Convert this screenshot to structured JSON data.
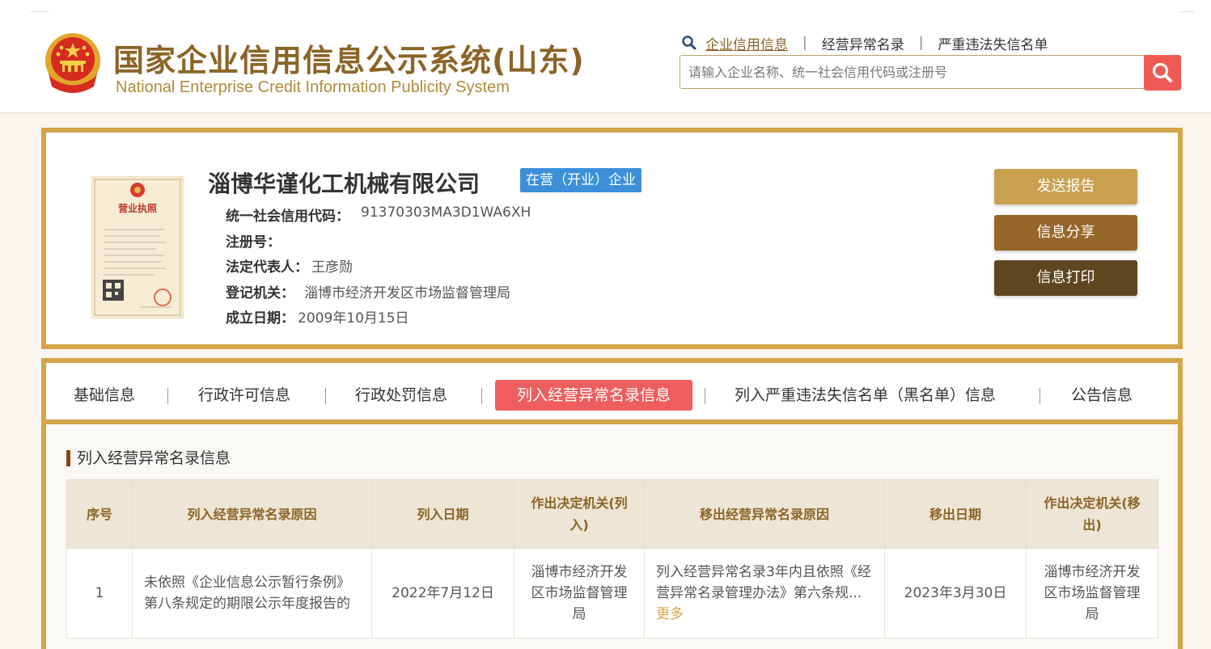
{
  "header": {
    "title": "国家企业信用信息公示系统(山东)",
    "subtitle": "National Enterprise Credit Information Publicity System",
    "nav": {
      "credit_info": "企业信用信息",
      "abnormal_list": "经营异常名录",
      "serious_violation": "严重违法失信名单"
    },
    "search": {
      "placeholder": "请输入企业名称、统一社会信用代码或注册号"
    }
  },
  "company": {
    "name": "淄博华谨化工机械有限公司",
    "status": "在营（开业）企业",
    "credit_code_label": "统一社会信用代码：",
    "credit_code": "91370303MA3D1WA6XH",
    "reg_no_label": "注册号：",
    "reg_no": "",
    "legal_rep_label": "法定代表人：",
    "legal_rep": "王彦勋",
    "authority_label": "登记机关：",
    "authority": "淄博市经济开发区市场监督管理局",
    "founded_label": "成立日期：",
    "founded": "2009年10月15日",
    "license_image": {
      "title": "营业执照"
    }
  },
  "actions": {
    "send_report": "发送报告",
    "share": "信息分享",
    "print": "信息打印"
  },
  "tabs": [
    {
      "label": "基础信息"
    },
    {
      "label": "行政许可信息"
    },
    {
      "label": "行政处罚信息"
    },
    {
      "label": "列入经营异常名录信息"
    },
    {
      "label": "列入严重违法失信名单（黑名单）信息"
    },
    {
      "label": "公告信息"
    }
  ],
  "section": {
    "title": "列入经营异常名录信息",
    "columns": [
      "序号",
      "列入经营异常名录原因",
      "列入日期",
      "作出决定机关(列入)",
      "移出经营异常名录原因",
      "移出日期",
      "作出决定机关(移出)"
    ],
    "rows": [
      {
        "no": "1",
        "reason_in": "未依照《企业信息公示暂行条例》第八条规定的期限公示年度报告的",
        "date_in": "2022年7月12日",
        "authority_in": "淄博市经济开发区市场监督管理局",
        "reason_out": "列入经营异常名录3年内且依照《经营异常名录管理办法》第六条规...",
        "more": "更多",
        "date_out": "2023年3月30日",
        "authority_out": "淄博市经济开发区市场监督管理局"
      }
    ]
  },
  "colors": {
    "gold_border": "#d3a44a",
    "title_brown": "#8b6426",
    "status_blue": "#3d8fd9",
    "active_tab_red": "#ef5e5e",
    "search_red": "#f05a54",
    "btn_send": "#c9a050",
    "btn_share": "#97662a",
    "btn_print": "#5e4620"
  },
  "icons": {
    "emblem": "national-emblem-icon",
    "nav_search": "search-icon",
    "search_button": "search-icon"
  }
}
